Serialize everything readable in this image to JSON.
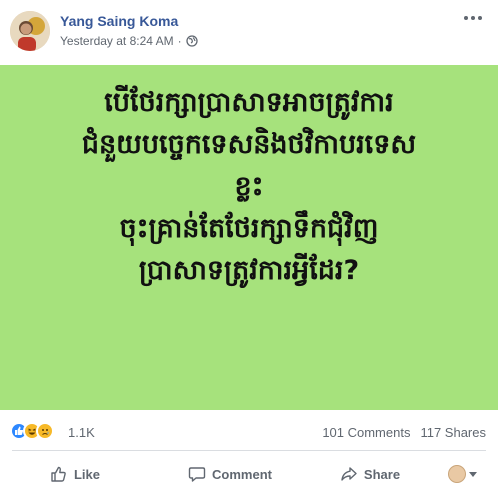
{
  "post": {
    "author": "Yang Saing Koma",
    "timestamp": "Yesterday at 8:24 AM",
    "separator": "·",
    "privacy_icon": "globe-icon",
    "menu_icon": "more-options-icon"
  },
  "image": {
    "background": "#a6e27c",
    "lines": [
      "បើថែរក្សាប្រាសាទអាចត្រូវការ",
      "ជំនួយបច្ចេកទេសនិងថវិកាបរទេស",
      "ខ្លះ",
      "ចុះគ្រាន់តែថែរក្សាទឹកជុំវិញ",
      "ប្រាសាទត្រូវការអ្វីដែរ?"
    ]
  },
  "reactions": {
    "types": [
      "like",
      "haha",
      "sad"
    ],
    "count": "1.1K",
    "comments": "101 Comments",
    "shares": "117 Shares"
  },
  "actions": {
    "like": "Like",
    "comment": "Comment",
    "share": "Share"
  },
  "colors": {
    "author_link": "#385898",
    "meta_text": "#606770",
    "like_blue": "#2d88ff",
    "emoji_yellow": "#f7b928"
  }
}
